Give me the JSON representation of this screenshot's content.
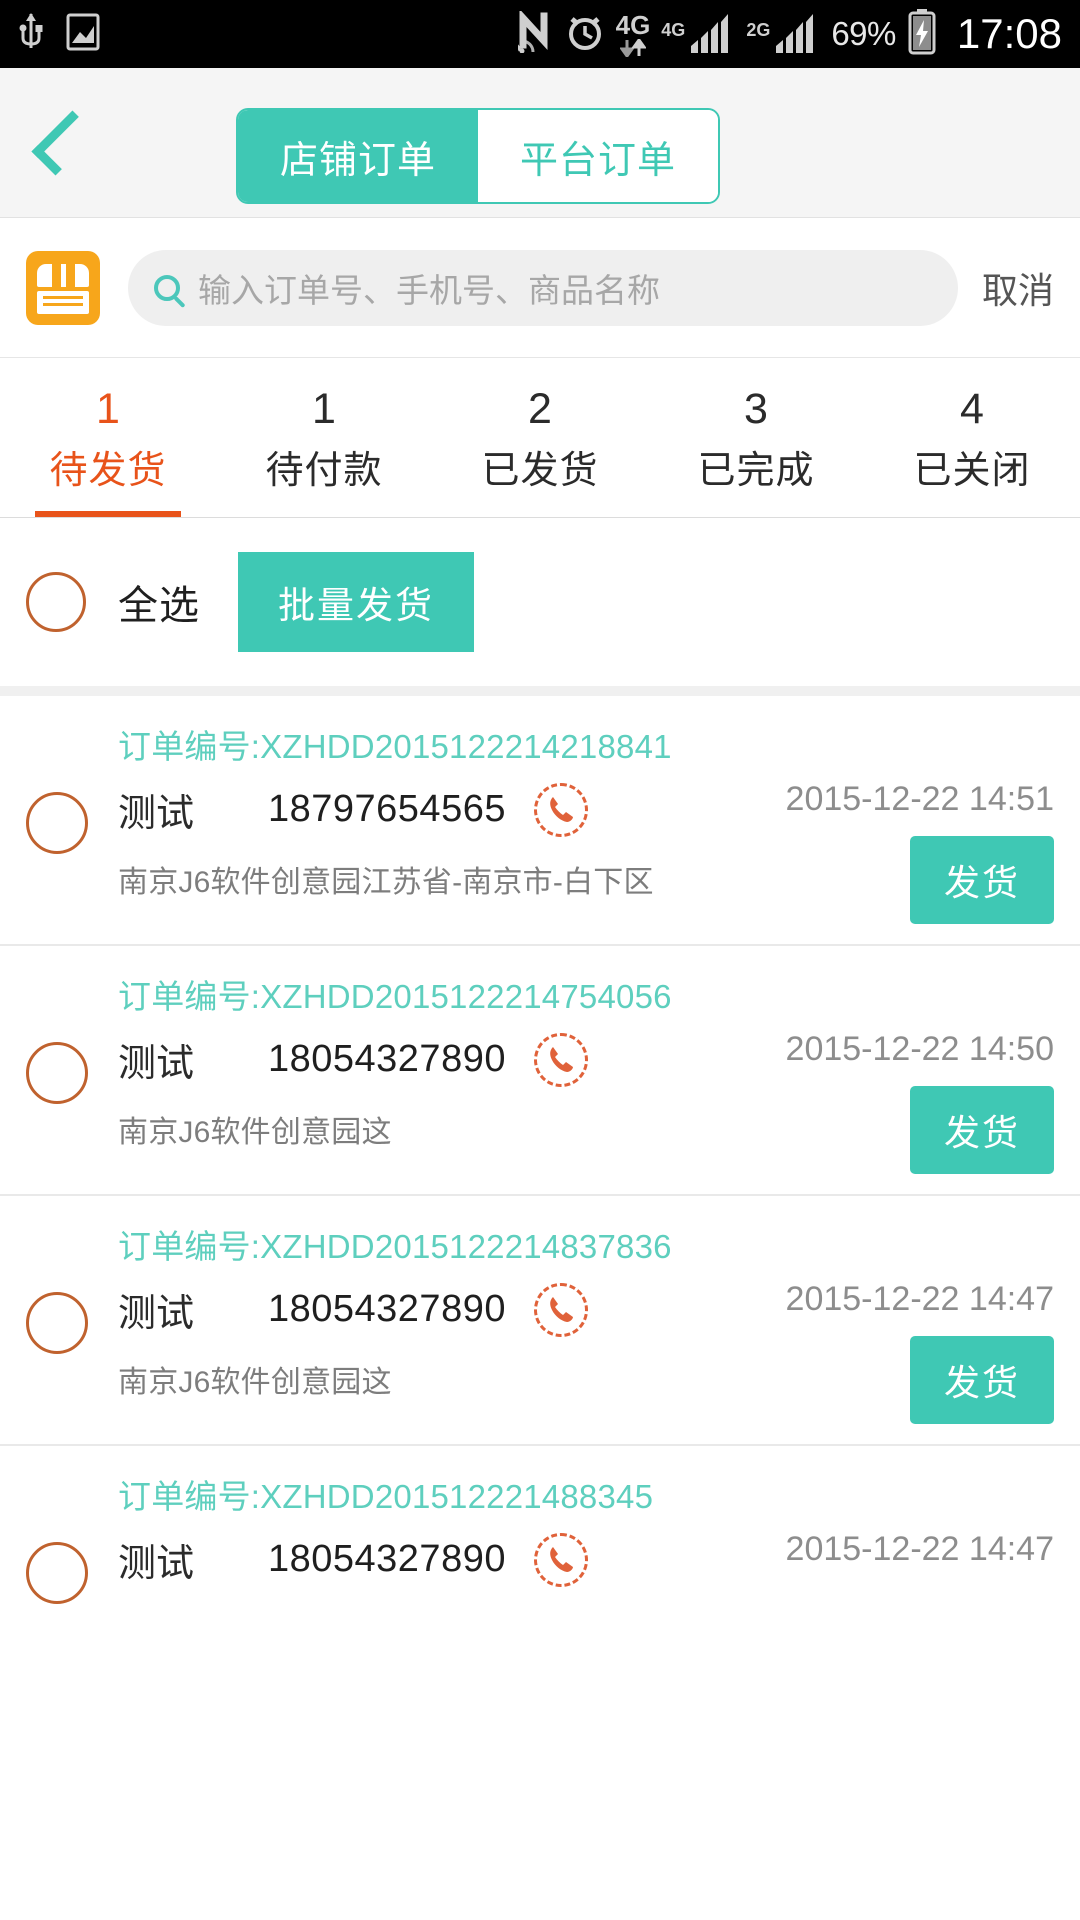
{
  "statusbar": {
    "icons": [
      "usb-icon",
      "screenshot-icon",
      "nfc-icon",
      "alarm-icon"
    ],
    "network_primary": "4G",
    "network_secondary": "4G",
    "network_tertiary": "2G",
    "battery_percent": "69%",
    "clock": "17:08"
  },
  "header": {
    "back_icon": "chevron-left-icon",
    "tabs": [
      {
        "label": "店铺订单",
        "active": true
      },
      {
        "label": "平台订单",
        "active": false
      }
    ],
    "accent_color": "#3fc8b4"
  },
  "search": {
    "store_icon": "store-icon",
    "search_icon": "search-icon",
    "placeholder": "输入订单号、手机号、商品名称",
    "value": "",
    "cancel_label": "取消"
  },
  "status_tabs": [
    {
      "count": "1",
      "label": "待发货",
      "active": true
    },
    {
      "count": "1",
      "label": "待付款",
      "active": false
    },
    {
      "count": "2",
      "label": "已发货",
      "active": false
    },
    {
      "count": "3",
      "label": "已完成",
      "active": false
    },
    {
      "count": "4",
      "label": "已关闭",
      "active": false
    }
  ],
  "active_tab_color": "#e8531a",
  "bulk_bar": {
    "select_all_label": "全选",
    "select_all_checked": false,
    "batch_ship_label": "批量发货"
  },
  "orders": [
    {
      "order_no_label": "订单编号:XZHDD2015122214218841",
      "checked": false,
      "customer": "测试",
      "phone": "18797654565",
      "phone_icon": "phone-call-icon",
      "date": "2015-12-22 14:51",
      "address": "南京J6软件创意园江苏省-南京市-白下区",
      "action_label": "发货"
    },
    {
      "order_no_label": "订单编号:XZHDD2015122214754056",
      "checked": false,
      "customer": "测试",
      "phone": "18054327890",
      "phone_icon": "phone-call-icon",
      "date": "2015-12-22 14:50",
      "address": "南京J6软件创意园这",
      "action_label": "发货"
    },
    {
      "order_no_label": "订单编号:XZHDD2015122214837836",
      "checked": false,
      "customer": "测试",
      "phone": "18054327890",
      "phone_icon": "phone-call-icon",
      "date": "2015-12-22 14:47",
      "address": "南京J6软件创意园这",
      "action_label": "发货"
    },
    {
      "order_no_label": "订单编号:XZHDD201512221488345",
      "checked": false,
      "customer": "测试",
      "phone": "18054327890",
      "phone_icon": "phone-call-icon",
      "date": "2015-12-22 14:47",
      "address": "",
      "action_label": ""
    }
  ]
}
